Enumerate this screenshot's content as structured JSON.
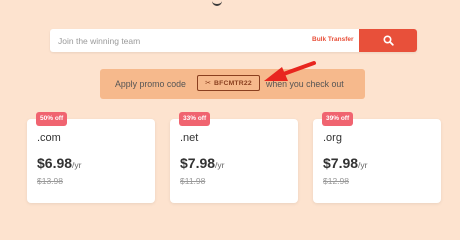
{
  "search": {
    "placeholder": "Join the winning team",
    "bulk_label": "Bulk Transfer",
    "button_icon": "search-icon"
  },
  "promo": {
    "text_before": "Apply promo code",
    "code": "BFCMTR22",
    "code_icon": "scissors-icon",
    "text_after": "when you check out"
  },
  "annotation": {
    "arrow_color": "#e8261f"
  },
  "colors": {
    "background": "#fde3cf",
    "accent": "#e8503a",
    "promo_background": "#f6b98c",
    "badge": "#f06470"
  },
  "cards": [
    {
      "badge": "50% off",
      "tld": ".com",
      "price": "$6.98",
      "unit": "/yr",
      "old_price": "$13.98"
    },
    {
      "badge": "33% off",
      "tld": ".net",
      "price": "$7.98",
      "unit": "/yr",
      "old_price": "$11.98"
    },
    {
      "badge": "39% off",
      "tld": ".org",
      "price": "$7.98",
      "unit": "/yr",
      "old_price": "$12.98"
    }
  ]
}
